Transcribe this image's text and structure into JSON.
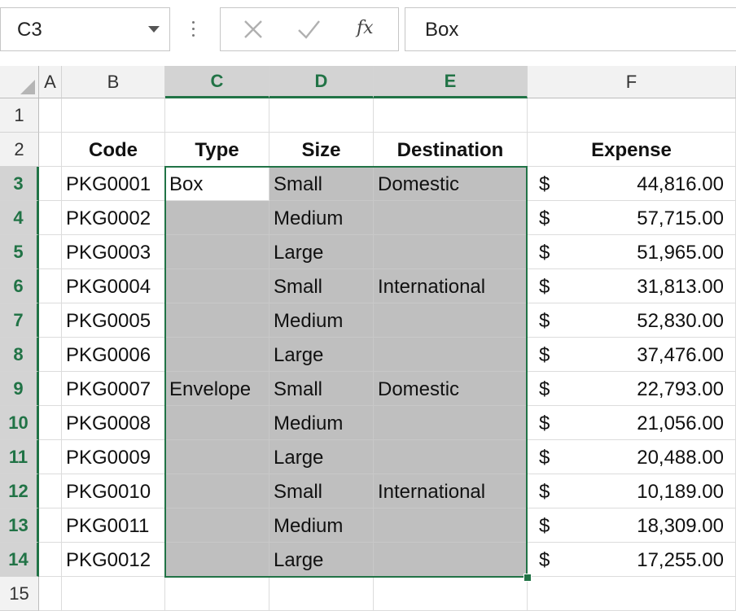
{
  "name_box": {
    "value": "C3"
  },
  "formula_bar": {
    "value": "Box",
    "fx_label": "fx"
  },
  "columns": [
    "A",
    "B",
    "C",
    "D",
    "E",
    "F"
  ],
  "selected_columns": [
    "C",
    "D",
    "E"
  ],
  "row_numbers": [
    "1",
    "2",
    "3",
    "4",
    "5",
    "6",
    "7",
    "8",
    "9",
    "10",
    "11",
    "12",
    "13",
    "14",
    "15"
  ],
  "selected_rows": [
    "3",
    "4",
    "5",
    "6",
    "7",
    "8",
    "9",
    "10",
    "11",
    "12",
    "13",
    "14"
  ],
  "headers": {
    "code": "Code",
    "type": "Type",
    "size": "Size",
    "destination": "Destination",
    "expense": "Expense"
  },
  "currency_symbol": "$",
  "rows": [
    {
      "code": "PKG0001",
      "type": "Box",
      "size": "Small",
      "destination": "Domestic",
      "expense": "44,816.00"
    },
    {
      "code": "PKG0002",
      "type": "",
      "size": "Medium",
      "destination": "",
      "expense": "57,715.00"
    },
    {
      "code": "PKG0003",
      "type": "",
      "size": "Large",
      "destination": "",
      "expense": "51,965.00"
    },
    {
      "code": "PKG0004",
      "type": "",
      "size": "Small",
      "destination": "International",
      "expense": "31,813.00"
    },
    {
      "code": "PKG0005",
      "type": "",
      "size": "Medium",
      "destination": "",
      "expense": "52,830.00"
    },
    {
      "code": "PKG0006",
      "type": "",
      "size": "Large",
      "destination": "",
      "expense": "37,476.00"
    },
    {
      "code": "PKG0007",
      "type": "Envelope",
      "size": "Small",
      "destination": "Domestic",
      "expense": "22,793.00"
    },
    {
      "code": "PKG0008",
      "type": "",
      "size": "Medium",
      "destination": "",
      "expense": "21,056.00"
    },
    {
      "code": "PKG0009",
      "type": "",
      "size": "Large",
      "destination": "",
      "expense": "20,488.00"
    },
    {
      "code": "PKG0010",
      "type": "",
      "size": "Small",
      "destination": "International",
      "expense": "10,189.00"
    },
    {
      "code": "PKG0011",
      "type": "",
      "size": "Medium",
      "destination": "",
      "expense": "18,309.00"
    },
    {
      "code": "PKG0012",
      "type": "",
      "size": "Large",
      "destination": "",
      "expense": "17,255.00"
    }
  ],
  "colors": {
    "accent": "#217346",
    "selection_fill": "#bfbfbf",
    "header_bg": "#f2f2f2"
  }
}
